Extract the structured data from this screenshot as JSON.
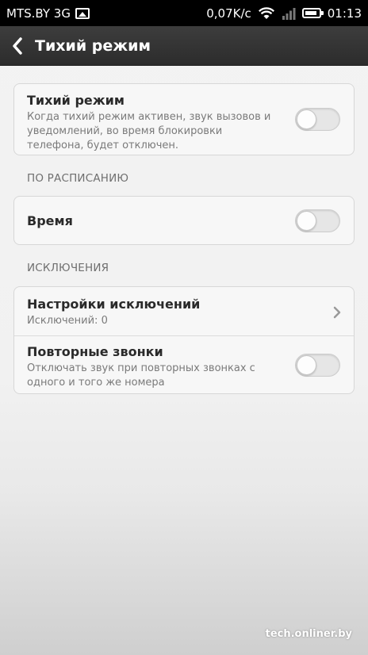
{
  "status_bar": {
    "carrier": "MTS.BY 3G",
    "speed": "0,07K/c",
    "time": "01:13",
    "battery_level": 0.85,
    "icons": [
      "image-notification-icon",
      "wifi-icon",
      "signal-icon",
      "battery-icon"
    ]
  },
  "header": {
    "title": "Тихий режим",
    "back_icon": "back-arrow-icon"
  },
  "quiet_mode": {
    "title": "Тихий режим",
    "description": "Когда тихий режим активен, звук вызовов и уведомлений, во время блокировки телефона, будет отключен.",
    "enabled": false
  },
  "schedule": {
    "section_label": "ПО РАСПИСАНИЮ",
    "time_label": "Время",
    "enabled": false
  },
  "exceptions": {
    "section_label": "ИСКЛЮЧЕНИЯ",
    "settings_title": "Настройки исключений",
    "settings_sub": "Исключений: 0",
    "repeat_title": "Повторные звонки",
    "repeat_desc": "Отключать звук при повторных звонках с одного и того же номера",
    "repeat_enabled": false
  },
  "watermark": "tech.onliner.by",
  "colors": {
    "status_bar_bg": "#000000",
    "title_bar_bg": "#333333",
    "card_bg": "#f7f7f7",
    "toggle_off": "#e6e6e6"
  }
}
